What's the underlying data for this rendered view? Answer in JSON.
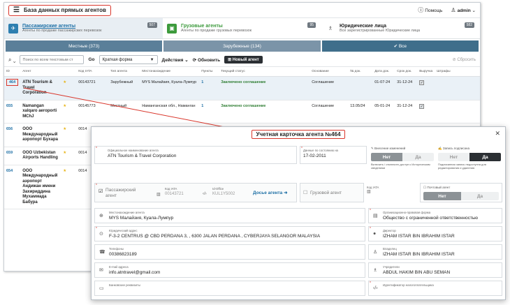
{
  "app": {
    "title": "База данных прямых агентов",
    "help": "Помощь",
    "user": "admin"
  },
  "categories": [
    {
      "title": "Пассажирские агенты",
      "subtitle": "Агенты по продаже пассажирских перевозок",
      "count": "507",
      "color": "#2e7fb0"
    },
    {
      "title": "Грузовые агенты",
      "subtitle": "Агенты по продаже грузовых перевозок",
      "count": "95",
      "color": "#3c9a3c"
    },
    {
      "title": "Юридические лица",
      "subtitle": "Все зарегистрированные Юридические лица",
      "count": "582",
      "color": "#555"
    }
  ],
  "tabs": [
    {
      "label": "Местные  (373)",
      "color": "#5a7f99"
    },
    {
      "label": "Зарубежные  (134)",
      "color": "#7b94a8"
    },
    {
      "label": "✔  Все",
      "color": "#3f6e8b"
    }
  ],
  "toolbar": {
    "search_placeholder": "Поиск по всем текстовым ст",
    "go": "Go",
    "view": "Краткая форма",
    "actions": "Действия",
    "refresh": "Обновить",
    "new": "Новый агент",
    "reset": "Сбросить"
  },
  "table": {
    "headers": [
      "ID",
      "Агент",
      "",
      "Код IATA",
      "Тип агента",
      "Местонахождение",
      "Пункты",
      "Текущий статус",
      "Основание",
      "№ док.",
      "Дата док.",
      "Срок док.",
      "Выручка",
      "Штрафы"
    ],
    "rows": [
      {
        "id": "464",
        "agent": "ATN Tourism & Travel Corporation",
        "iata": "00143721",
        "type": "Зарубежный",
        "location": "MYS Малайзия, Куала-Лумпур",
        "points": "1",
        "status": "Заключено соглашение",
        "basis": "Соглашение",
        "docno": "",
        "docdate": "01-07-24",
        "docterm": "31-12-24"
      },
      {
        "id": "655",
        "agent": "Namangan xalqaro aeroporti MChJ",
        "iata": "00145773",
        "type": "Местный",
        "location": "Наманганская обл., Наманган",
        "points": "1",
        "status": "Заключено соглашение",
        "basis": "Соглашение",
        "docno": "13.05/24",
        "docdate": "05-01-24",
        "docterm": "31-12-24"
      },
      {
        "id": "656",
        "agent": "ООО Международный аэропорт Бухара",
        "iata": "0014",
        "type": "",
        "location": "",
        "points": "",
        "status": "",
        "basis": "",
        "docno": "",
        "docdate": "",
        "docterm": ""
      },
      {
        "id": "659",
        "agent": "ООО Uzbekistan Airports Handling",
        "iata": "0014",
        "type": "",
        "location": "",
        "points": "",
        "status": "",
        "basis": "",
        "docno": "",
        "docdate": "",
        "docterm": ""
      },
      {
        "id": "654",
        "agent": "ООО Международный аэропорт Андижан имени Захириддина Мухаммада Бабура",
        "iata": "0014",
        "type": "",
        "location": "",
        "points": "",
        "status": "",
        "basis": "",
        "docno": "",
        "docdate": "",
        "docterm": ""
      }
    ]
  },
  "modal": {
    "title": "Учетная карточка агента №464",
    "official_name_label": "Официальное наименование агента",
    "official_name": "ATN Tourism & Travel Corporation",
    "data_as_of_label": "Данные по состоянию на",
    "data_as_of": "17-02-2011",
    "changes_label": "Внесение изменений",
    "changes_no": "Нет",
    "changes_yes": "Да",
    "changes_note": "Включить / отключить доступ к Историческим сведениям",
    "sign_label": "Запись подписана",
    "sign_no": "Нет",
    "sign_yes": "Да",
    "sign_note": "Подписанная запись недоступна для редактирования и удаления",
    "pass_agent_label": "Пассажирский агент",
    "iata_label": "Код IATA",
    "iata_value": "00143721",
    "office_label": "Id-Office",
    "office_value": "KUL1Y5002",
    "docs_link": "Досье агента",
    "cargo_agent_label": "Грузовой агент",
    "cargo_iata_label": "Код IATA",
    "postal_label": "Почтовый агент",
    "postal_no": "Нет",
    "postal_yes": "Да",
    "location_label": "Местонахождение агента",
    "location": "MYS Малайзия, Куала-Лумпур",
    "legal_form_label": "Организационно-правовая форма",
    "legal_form": "Общество с ограниченной ответственностью",
    "legal_addr_label": "Юридический адрес",
    "legal_addr": "F-3-2 CENTRUS @ CBD PERDANA 3, , 6300 JALAN PERDANA , CYBERJAYA SELANGOR MALAYSIA",
    "director_label": "Директор",
    "director": "IZHAM ISTAR BIN IBRAHIM ISTAR",
    "phone_label": "Телефоны",
    "phone": "00386823189",
    "owner_label": "Владелец",
    "owner": "IZHAM ISTAR BIN IBRAHIM ISTAR",
    "email_label": "E-mail адреса",
    "email": "info.atntravel@gmail.com",
    "founder_label": "Учредители",
    "founder": "ABDUL HAKIM BIN ABU SEMAN",
    "bank_label": "Банковские реквизиты",
    "taxid_label": "Идентификатор налогоплательщика"
  },
  "colors": {
    "accent_red": "#d9352a",
    "link_blue": "#1d6fa5",
    "status_green": "#2e7d32"
  }
}
